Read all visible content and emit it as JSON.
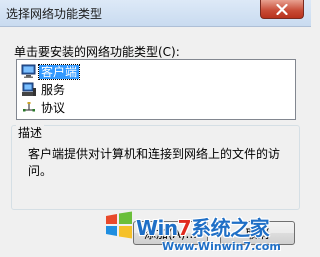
{
  "window": {
    "title": "选择网络功能类型"
  },
  "prompt": "单击要安装的网络功能类型(C):",
  "list": {
    "items": [
      {
        "label": "客户端",
        "icon": "client-computer-icon",
        "selected": true
      },
      {
        "label": "服务",
        "icon": "service-computer-icon",
        "selected": false
      },
      {
        "label": "协议",
        "icon": "protocol-network-icon",
        "selected": false
      }
    ]
  },
  "description": {
    "title": "描述",
    "text": "客户端提供对计算机和连接到网络上的文件的访问。"
  },
  "buttons": {
    "add": "添加(A)...",
    "cancel": "取消"
  },
  "watermark": {
    "brand_prefix": "Win",
    "brand_seven": "7",
    "brand_suffix": "系统之家",
    "url": "Www.Winwin7.com"
  },
  "colors": {
    "selection": "#3399ff",
    "close_button": "#c74a35",
    "watermark_blue": "#1f6fc6",
    "watermark_red": "#e02a1f"
  }
}
